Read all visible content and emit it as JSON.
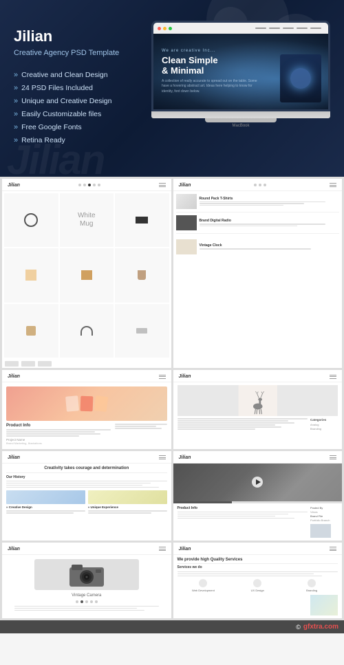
{
  "hero": {
    "title": "Jilian",
    "subtitle": "Creative Agency PSD Template",
    "features": [
      "Creative and Clean Design",
      "24 PSD Files Included",
      "Unique and Creative Design",
      "Easily Customizable files",
      "Free Google Fonts",
      "Retina Ready"
    ],
    "screen": {
      "tagline": "We are creative Inc...",
      "headline1": "Clean Simple",
      "headline2": "& Minimal",
      "description": "A collection of really accurate to spread out on the table. Some have a hovering abstract art. Ideas here helping to know for identity, font down below."
    },
    "laptop_label": "MacBook",
    "watermark": "Jilian"
  },
  "pages": [
    {
      "id": "shop-page",
      "logo": "Jilian",
      "nav": "Menu",
      "type": "shop"
    },
    {
      "id": "product-detail-page",
      "logo": "Jilian",
      "nav": "Menu",
      "type": "product-detail",
      "items": [
        {
          "title": "Round Pack T-Shirts",
          "desc": "description text here"
        },
        {
          "title": "Brand Digital Radio",
          "desc": "description text here"
        },
        {
          "title": "Vintage Clock",
          "desc": "description text here"
        }
      ]
    },
    {
      "id": "portfolio-page",
      "logo": "Jilian",
      "nav": "Menu",
      "type": "portfolio",
      "product_title": "Product Info",
      "labels": [
        "Project Name",
        "Brand Marketing, Illustrations"
      ]
    },
    {
      "id": "blog-page",
      "logo": "Jilian",
      "nav": "Menu",
      "type": "blog",
      "categories": [
        "Categories",
        "Analog",
        "Branding"
      ]
    },
    {
      "id": "about-page",
      "logo": "Jilian",
      "nav": "Menu",
      "type": "about",
      "title": "Creativity takes courage and determination",
      "history_title": "Our History",
      "col1_title": "» Creative Design",
      "col2_title": "» Unique Experience"
    },
    {
      "id": "video-page",
      "logo": "Jilian",
      "nav": "Menu",
      "type": "video",
      "product_title": "Product Info",
      "labels": [
        "Posted By",
        "Views",
        "Brand File",
        "Portfolio Branch"
      ]
    },
    {
      "id": "camera-page",
      "logo": "Jilian",
      "nav": "Menu",
      "type": "camera",
      "label": "Vintage Camera"
    },
    {
      "id": "services-page",
      "logo": "Jilian",
      "nav": "Menu",
      "type": "services",
      "title": "We provide high Quality Services",
      "subtitle": "Services we do",
      "service1": "Web Development",
      "service2": "UX Design",
      "service3": "Branding"
    }
  ],
  "watermark": {
    "site": "gfxtra.com"
  }
}
